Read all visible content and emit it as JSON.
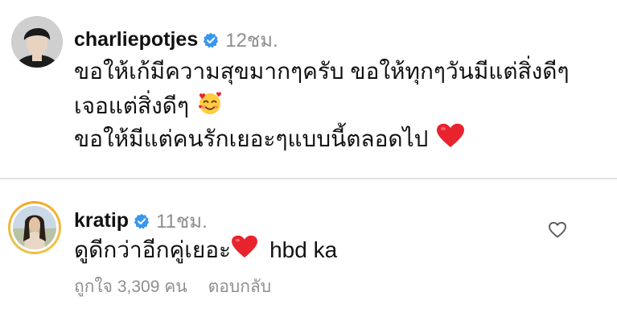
{
  "comments": [
    {
      "username": "charliepotjes",
      "verified": true,
      "timestamp": "12ชม.",
      "lines": [
        "ขอให้เก้มีความสุขมากๆครับ ขอให้ทุกๆวันมีแต่สิ่งดีๆ",
        "เจอแต่สิ่งดีๆ",
        "ขอให้มีแต่คนรักเยอะๆแบบนี้ตลอดไป"
      ],
      "emojis": [
        "smiling-face-with-hearts",
        "red-heart"
      ]
    },
    {
      "username": "kratip",
      "verified": true,
      "timestamp": "11ชม.",
      "text_before_emoji": "ดูดีกว่าอีกคู่เยอะ",
      "text_after_emoji": "hbd ka",
      "emoji": "red-heart",
      "likes_label": "ถูกใจ 3,309 คน",
      "reply_label": "ตอบกลับ"
    }
  ],
  "colors": {
    "verified_blue": "#3897f0",
    "heart_red": "#e8232e",
    "muted_text": "#8e8e8e",
    "divider": "#e3e3e3"
  }
}
